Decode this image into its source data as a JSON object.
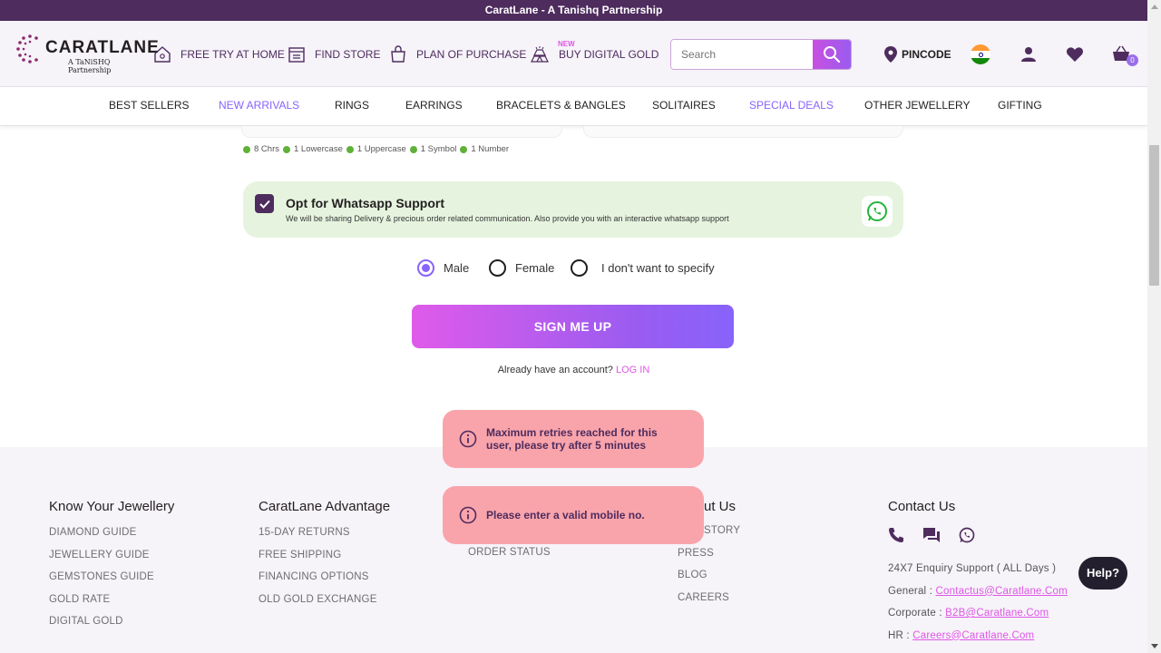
{
  "topbar": {
    "text": "CaratLane - A Tanishq Partnership"
  },
  "header": {
    "logo_name": "CARATLANE",
    "logo_tag": "A TaNiSHQ Partnership",
    "nav": [
      {
        "label": "FREE TRY AT HOME"
      },
      {
        "label": "FIND STORE"
      },
      {
        "label": "PLAN OF PURCHASE"
      },
      {
        "label": "BUY DIGITAL GOLD",
        "badge": "NEW"
      }
    ],
    "search_placeholder": "Search",
    "pincode": "PINCODE",
    "cart_count": "0"
  },
  "categories": [
    "BEST SELLERS",
    "NEW ARRIVALS",
    "RINGS",
    "EARRINGS",
    "BRACELETS & BANGLES",
    "SOLITAIRES",
    "SPECIAL DEALS",
    "OTHER JEWELLERY",
    "GIFTING"
  ],
  "password_rules": [
    "8 Chrs",
    "1 Lowercase",
    "1 Uppercase",
    "1 Symbol",
    "1 Number"
  ],
  "whatsapp": {
    "title": "Opt for Whatsapp Support",
    "desc": "We will be sharing Delivery & precious order related communication. Also provide you with an interactive whatsapp support",
    "checked": true
  },
  "gender": {
    "options": [
      "Male",
      "Female",
      "I don't want to specify"
    ],
    "selected": "Male"
  },
  "signup_label": "SIGN ME UP",
  "already": {
    "text": "Already have an account?",
    "link": "LOG IN"
  },
  "toasts": [
    "Maximum retries reached for this user, please try after 5 minutes",
    "Please enter a valid mobile no."
  ],
  "footer": {
    "know": {
      "heading": "Know Your Jewellery",
      "links": [
        "DIAMOND GUIDE",
        "JEWELLERY GUIDE",
        "GEMSTONES GUIDE",
        "GOLD RATE",
        "DIGITAL GOLD"
      ]
    },
    "advantage": {
      "heading": "CaratLane Advantage",
      "links": [
        "15-DAY RETURNS",
        "FREE SHIPPING",
        "FINANCING OPTIONS",
        "OLD GOLD EXCHANGE"
      ]
    },
    "col3": {
      "links": [
        "ORDER STATUS"
      ]
    },
    "about": {
      "heading": "ut Us",
      "links": [
        "STORY",
        "PRESS",
        "BLOG",
        "CAREERS"
      ]
    },
    "contact": {
      "heading": "Contact Us",
      "support": "24X7 Enquiry Support ( ALL Days )",
      "general_label": "General :",
      "general_email": "Contactus@Caratlane.Com",
      "corporate_label": "Corporate :",
      "corporate_email": "B2B@Caratlane.Com",
      "hr_label": "HR :",
      "hr_email": "Careers@Caratlane.Com"
    }
  },
  "help_label": "Help?",
  "colors": {
    "brand": "#4e2c5e",
    "accent": "#8863fb",
    "pink": "#de57e5",
    "toast": "#f9a4ab"
  }
}
